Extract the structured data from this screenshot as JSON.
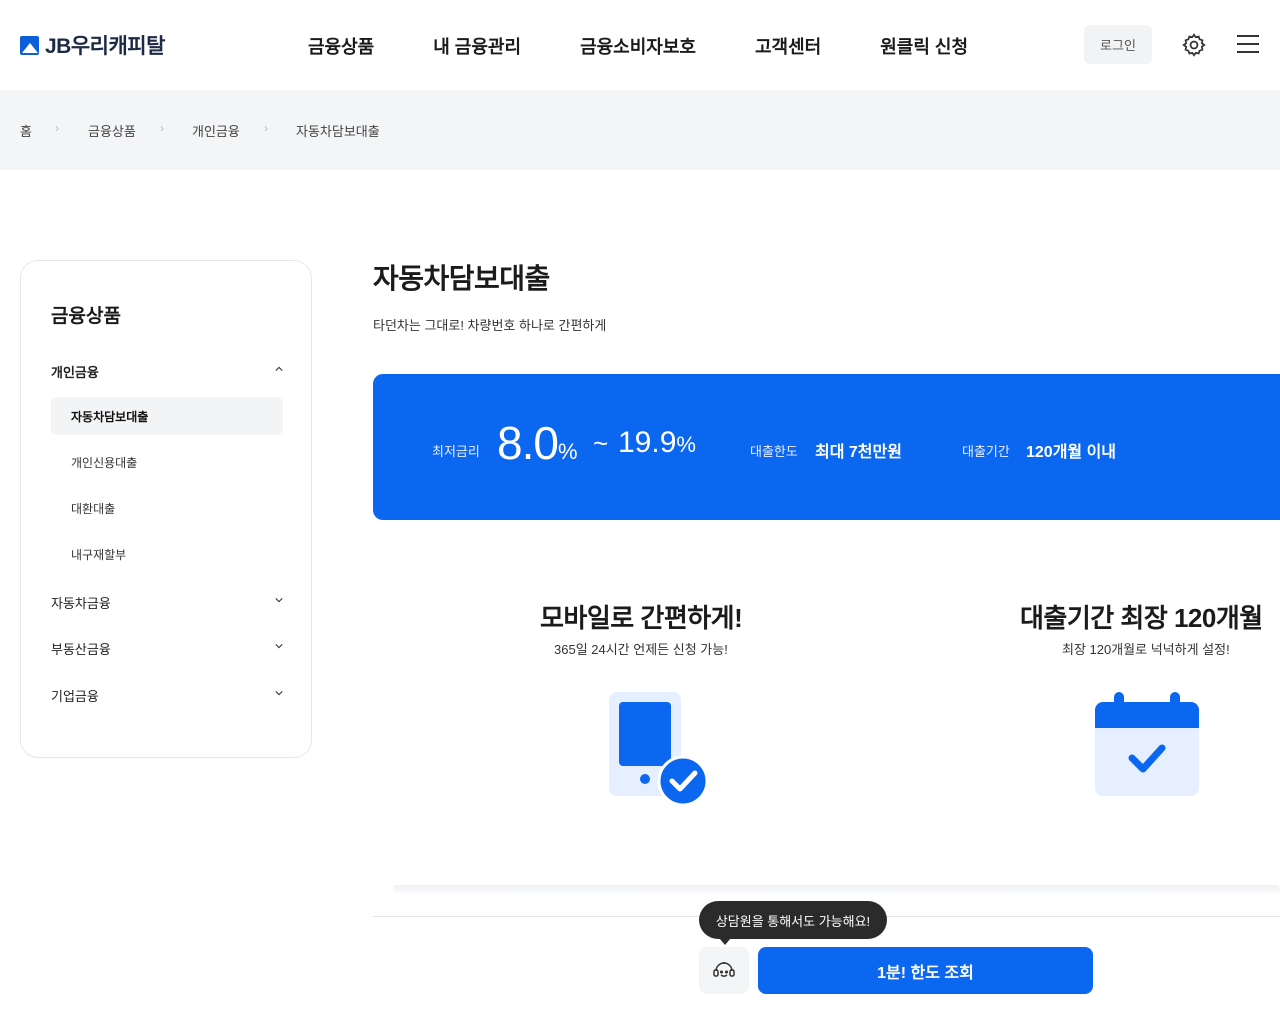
{
  "header": {
    "logo_text": "JB우리캐피탈",
    "nav": [
      "금융상품",
      "내 금융관리",
      "금융소비자보호",
      "고객센터",
      "원클릭 신청"
    ],
    "login_label": "로그인",
    "icons": [
      "gear-icon",
      "menu-icon"
    ]
  },
  "breadcrumb": [
    "홈",
    "금융상품",
    "개인금융",
    "자동차담보대출"
  ],
  "sidebar": {
    "title": "금융상품",
    "groups": [
      {
        "label": "개인금융",
        "expanded": true
      },
      {
        "label": "자동차금융",
        "expanded": false
      },
      {
        "label": "부동산금융",
        "expanded": false
      },
      {
        "label": "기업금융",
        "expanded": false
      }
    ],
    "sub_items": [
      "자동차담보대출",
      "개인신용대출",
      "대환대출",
      "내구재할부"
    ],
    "active_sub": "자동차담보대출"
  },
  "main": {
    "title": "자동차담보대출",
    "subtitle": "타던차는 그대로! 차량번호 하나로 간편하게",
    "banner": {
      "rate_label": "최저금리",
      "rate_min": "8.0",
      "rate_min_unit": "%",
      "rate_tilde": "~",
      "rate_max": "19.9",
      "rate_max_unit": "%",
      "limit_label": "대출한도",
      "limit_value": "최대 7천만원",
      "period_label": "대출기간",
      "period_value": "120개월 이내"
    },
    "features": [
      {
        "title": "모바일로 간편하게!",
        "desc": "365일 24시간 언제든 신청 가능!",
        "icon": "mobile-check-icon"
      },
      {
        "title": "대출기간 최장 120개월",
        "desc": "최장 120개월로 넉넉하게 설정!",
        "icon": "calendar-check-icon"
      }
    ]
  },
  "bottom": {
    "tooltip": "상담원을 통해서도 가능해요!",
    "counsel_icon": "headset-icon",
    "cta_label": "1분! 한도 조회"
  },
  "colors": {
    "primary": "#0b66f0",
    "surface": "#f4f5f7"
  }
}
